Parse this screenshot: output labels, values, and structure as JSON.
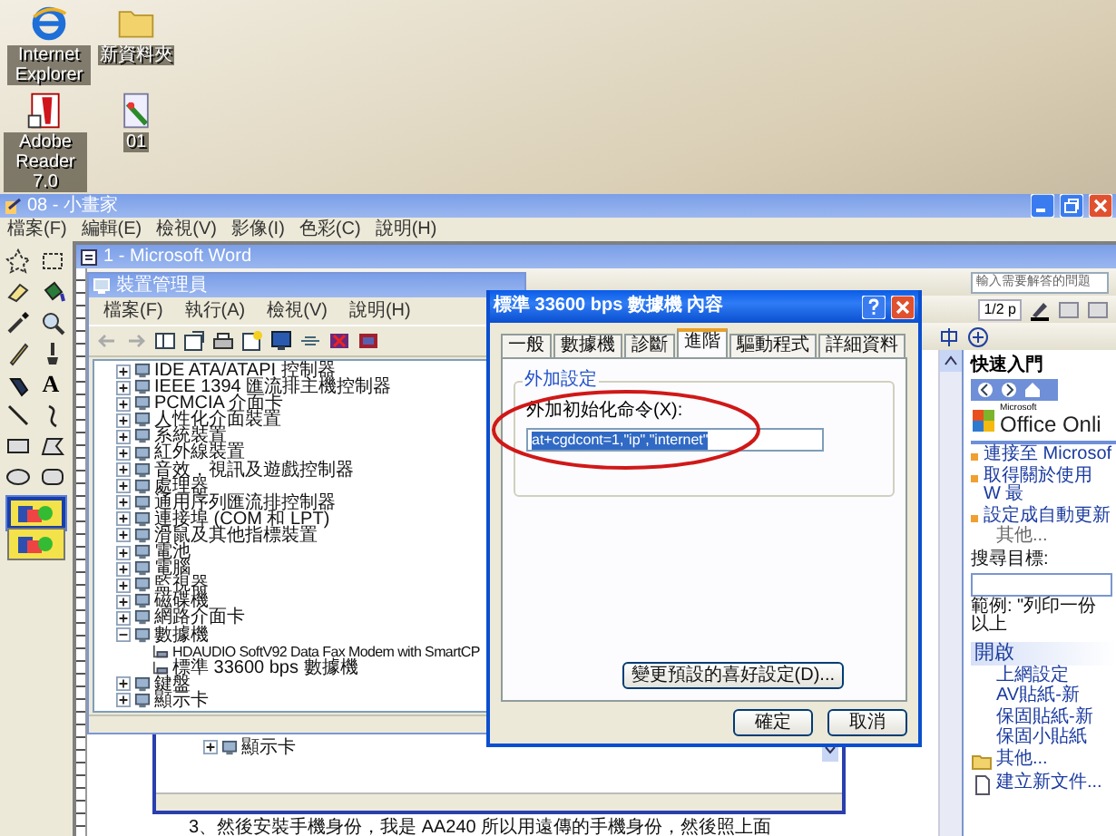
{
  "desktop": {
    "icons": [
      {
        "kind": "browser",
        "label": "Internet Explorer"
      },
      {
        "kind": "folder",
        "label": "新資料夾"
      },
      {
        "kind": "reader",
        "label": "Adobe Reader 7.0"
      },
      {
        "kind": "image",
        "label": "01"
      }
    ]
  },
  "paint": {
    "title": "08 - 小畫家",
    "menu": [
      "檔案(F)",
      "編輯(E)",
      "檢視(V)",
      "影像(I)",
      "色彩(C)",
      "說明(H)"
    ],
    "tools": [
      {
        "kind": "free-select"
      },
      {
        "kind": "rect-select"
      },
      {
        "kind": "eraser"
      },
      {
        "kind": "fill"
      },
      {
        "kind": "picker"
      },
      {
        "kind": "magnifier"
      },
      {
        "kind": "pencil"
      },
      {
        "kind": "brush"
      },
      {
        "kind": "airbrush"
      },
      {
        "kind": "text",
        "glyph": "A"
      },
      {
        "kind": "line"
      },
      {
        "kind": "curve"
      },
      {
        "kind": "rect"
      },
      {
        "kind": "polygon"
      },
      {
        "kind": "ellipse"
      },
      {
        "kind": "rounded-rect"
      }
    ],
    "options": [
      {
        "selected": true
      },
      {
        "selected": false
      }
    ]
  },
  "word": {
    "title": "1 - Microsoft Word",
    "help": {
      "placeholder": "輸入需要解答的問題"
    },
    "page_zoom": "1/2 p",
    "task_pane": {
      "title": "快速入門",
      "logo_small": "Microsoft",
      "logo": "Office Onli",
      "links": [
        "連接至 Microsof",
        "取得關於使用 W 最",
        "設定成自動更新"
      ],
      "more": "其他...",
      "search_label": "搜尋目標:",
      "example": "範例: \"列印一份以上",
      "open_title": "開啟",
      "files": [
        "上網設定",
        "AV貼紙-新",
        "保固貼紙-新",
        "保固小貼紙"
      ],
      "open_more": "其他...",
      "new_doc": "建立新文件..."
    },
    "document": {
      "tree_row": "顯示卡",
      "paragraph": "3、然後安裝手機身份，我是 AA240 所以用遠傳的手機身份，然後照上面"
    }
  },
  "device_manager": {
    "title": "裝置管理員",
    "menu": [
      "檔案(F)",
      "執行(A)",
      "檢視(V)",
      "說明(H)"
    ],
    "tree": [
      {
        "label": "IDE ATA/ATAPI 控制器",
        "expanded": false
      },
      {
        "label": "IEEE 1394 匯流排主機控制器",
        "expanded": false
      },
      {
        "label": "PCMCIA 介面卡",
        "expanded": false
      },
      {
        "label": "人性化介面裝置",
        "expanded": false
      },
      {
        "label": "系統裝置",
        "expanded": false
      },
      {
        "label": "紅外線裝置",
        "expanded": false
      },
      {
        "label": "音效，視訊及遊戲控制器",
        "expanded": false
      },
      {
        "label": "處理器",
        "expanded": false
      },
      {
        "label": "通用序列匯流排控制器",
        "expanded": false
      },
      {
        "label": "連接埠 (COM 和 LPT)",
        "expanded": false
      },
      {
        "label": "滑鼠及其他指標裝置",
        "expanded": false
      },
      {
        "label": "電池",
        "expanded": false
      },
      {
        "label": "電腦",
        "expanded": false
      },
      {
        "label": "監視器",
        "expanded": false
      },
      {
        "label": "磁碟機",
        "expanded": false
      },
      {
        "label": "網路介面卡",
        "expanded": false
      },
      {
        "label": "數據機",
        "expanded": true,
        "children": [
          {
            "label": "HDAUDIO SoftV92 Data Fax Modem with SmartCP"
          },
          {
            "label": "標準 33600 bps 數據機"
          }
        ]
      },
      {
        "label": "鍵盤",
        "expanded": false
      },
      {
        "label": "顯示卡",
        "expanded": false
      }
    ]
  },
  "dialog": {
    "title": "標準 33600 bps 數據機 內容",
    "tabs": [
      {
        "label": "一般",
        "selected": false
      },
      {
        "label": "數據機",
        "selected": false
      },
      {
        "label": "診斷",
        "selected": false
      },
      {
        "label": "進階",
        "selected": true
      },
      {
        "label": "驅動程式",
        "selected": false
      },
      {
        "label": "詳細資料",
        "selected": false
      }
    ],
    "group": "外加設定",
    "field_label": "外加初始化命令(X):",
    "field": {
      "value": "at+cgdcont=1,\"ip\",\"internet\""
    },
    "defaults_button": "變更預設的喜好設定(D)...",
    "buttons": [
      "確定",
      "取消"
    ]
  }
}
